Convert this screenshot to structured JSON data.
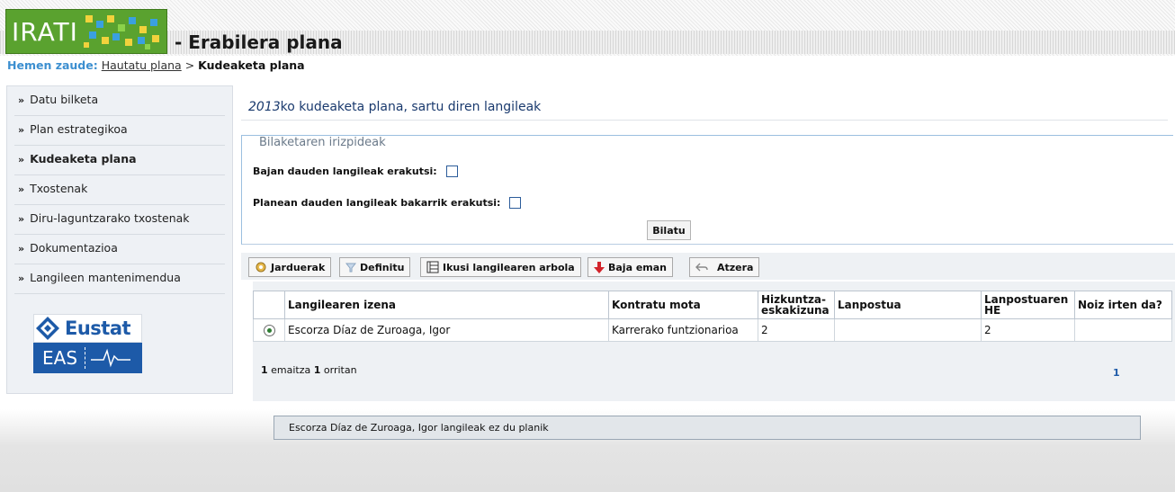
{
  "header": {
    "logo_text": "IRATI",
    "title": "- Erabilera plana",
    "colors": {
      "logo_green": "#5aa22f",
      "link_blue": "#3c8fd0"
    }
  },
  "breadcrumb": {
    "label": "Hemen zaude:",
    "link": "Hautatu plana",
    "separator": ">",
    "current": "Kudeaketa plana"
  },
  "sidebar": {
    "items": [
      {
        "label": "Datu bilketa",
        "active": false
      },
      {
        "label": "Plan estrategikoa",
        "active": false
      },
      {
        "label": "Kudeaketa plana",
        "active": true
      },
      {
        "label": "Txostenak",
        "active": false
      },
      {
        "label": "Diru-laguntzarako txostenak",
        "active": false
      },
      {
        "label": "Dokumentazioa",
        "active": false
      },
      {
        "label": "Langileen mantenimendua",
        "active": false
      }
    ],
    "eustat_label": "Eustat",
    "eas_label": "EAS"
  },
  "main": {
    "title_year": "2013",
    "title_rest": "ko kudeaketa plana, sartu diren langileak",
    "criteria": {
      "legend": "Bilaketaren irizpideak",
      "show_discharged_label": "Bajan dauden langileak erakutsi:",
      "show_discharged_checked": false,
      "only_plan_label": "Planean dauden langileak bakarrik erakutsi:",
      "only_plan_checked": false,
      "search_button": "Bilatu"
    },
    "toolbar": {
      "jarduerak": "Jarduerak",
      "definitu": "Definitu",
      "ikusi_arbola": "Ikusi langilearen arbola",
      "baja_eman": "Baja eman",
      "atzera": "Atzera"
    },
    "grid": {
      "headers": {
        "name": "Langilearen izena",
        "contract": "Kontratu mota",
        "language_req_1": "Hizkuntza-",
        "language_req_2": "eskakizuna",
        "position": "Lanpostua",
        "position_he_1": "Lanpostuaren",
        "position_he_2": "HE",
        "exit": "Noiz irten da?"
      },
      "rows": [
        {
          "selected": true,
          "name": "Escorza Díaz de Zuroaga, Igor",
          "contract": "Karrerako funtzionarioa",
          "language_req": "2",
          "position": "",
          "position_he": "2",
          "exit": ""
        }
      ],
      "results_count": "1",
      "results_mid": "emaitza",
      "results_pages": "1",
      "results_end": "orritan",
      "page_number": "1"
    },
    "message": "Escorza Díaz de Zuroaga, Igor langileak ez du planik"
  }
}
